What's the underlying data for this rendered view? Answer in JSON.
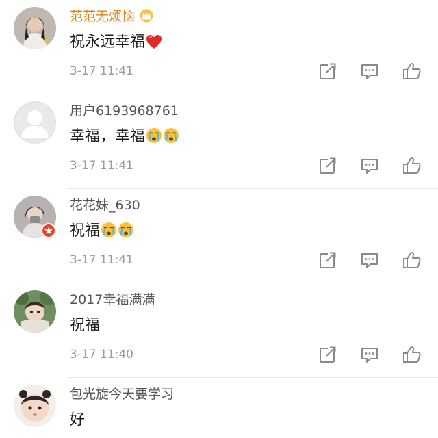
{
  "comments": [
    {
      "username": "范范无烦恼",
      "vip": true,
      "text": "祝永远幸福",
      "emoji": [
        "heart"
      ],
      "time": "3-17 11:41",
      "avatar": "photo-girl"
    },
    {
      "username": "用户6193968761",
      "vip": false,
      "text": "幸福，幸福",
      "emoji": [
        "crying-face",
        "crying-face"
      ],
      "time": "3-17 11:41",
      "avatar": "default-user"
    },
    {
      "username": "花花妹_630",
      "vip": false,
      "text": "祝福",
      "emoji": [
        "crying-face",
        "crying-face"
      ],
      "time": "3-17 11:41",
      "avatar": "photo-girl-badge"
    },
    {
      "username": "2017幸福满满",
      "vip": false,
      "text": "祝福",
      "emoji": [],
      "time": "3-17 11:40",
      "avatar": "photo-child"
    },
    {
      "username": "包光旋今天要学习",
      "vip": false,
      "text": "好",
      "emoji": [],
      "time": "",
      "avatar": "photo-baby"
    }
  ],
  "icons": {
    "share": "share-icon",
    "reply": "comment-icon",
    "like": "thumbs-up-icon",
    "vip": "crown-icon"
  },
  "colors": {
    "vip_name": "#e0851a",
    "name": "#555555",
    "text": "#1a1a1a",
    "time": "#9b9b9b",
    "icon": "#8a8a8a",
    "divider": "#e6e6e6",
    "badge": "#e2452a"
  }
}
